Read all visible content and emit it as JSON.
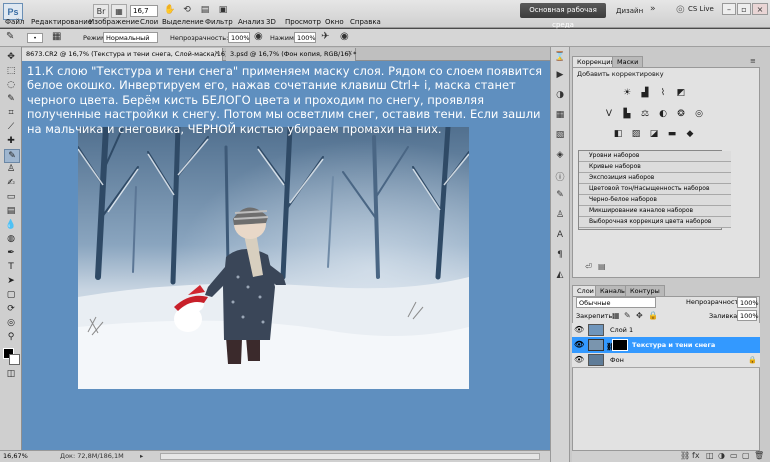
{
  "app": {
    "logo": "Ps"
  },
  "menu": [
    "Файл",
    "Редактирование",
    "Изображение",
    "Слои",
    "Выделение",
    "Фильтр",
    "Анализ",
    "3D",
    "Просмотр",
    "Окно",
    "Справка"
  ],
  "topbar": {
    "zoom": "16,7",
    "workspace": "Основная рабочая среда",
    "design": "Дизайн",
    "cslive": "CS Live"
  },
  "options": {
    "mode_label": "Режим:",
    "mode_value": "Нормальный",
    "opacity_label": "Непрозрачность:",
    "opacity_value": "100%",
    "flow_label": "Нажим:",
    "flow_value": "100%"
  },
  "tabs": [
    {
      "label": "8673.CR2 @ 16,7% (Текстура и тени снега, Слой-маска/16) *"
    },
    {
      "label": "3.psd @ 16,7% (Фон копия, RGB/16) *"
    }
  ],
  "instruction": "11.К слою \"Текстура и тени снега\" применяем маску слоя. Рядом со слоем появится белое окошко. Инвертируем его, нажав сочетание клавиш Ctrl+ i, маска станет черного цвета. Берём кисть БЕЛОГО цвета и проходим по снегу, проявляя полученные настройки к снегу. Потом мы осветлим снег, оставив тени. Если зашли на мальчика и снеговика, ЧЕРНОЙ кистью убираем промахи на них.",
  "status": {
    "zoom": "16,67%",
    "doc": "Док: 72,8M/186,1M"
  },
  "adjustments": {
    "tabs": [
      "Коррекция",
      "Маски"
    ],
    "title": "Добавить корректировку",
    "presets": [
      "Уровни наборов",
      "Кривые наборов",
      "Экспозиция наборов",
      "Цветовой тон/Насыщенность наборов",
      "Черно-белое наборов",
      "Микширование каналов наборов",
      "Выборочная коррекция цвета наборов"
    ]
  },
  "layers": {
    "tabs": [
      "Слои",
      "Каналы",
      "Контуры"
    ],
    "blend": "Обычные",
    "opacity_label": "Непрозрачность:",
    "opacity_value": "100%",
    "lock_label": "Закрепить:",
    "fill_label": "Заливка:",
    "fill_value": "100%",
    "items": [
      {
        "name": "Слой 1"
      },
      {
        "name": "Текстура и тени снега"
      },
      {
        "name": "Фон"
      }
    ]
  },
  "colors": {
    "canvas": "#5f8fbf",
    "selected_layer": "#3399ff"
  }
}
